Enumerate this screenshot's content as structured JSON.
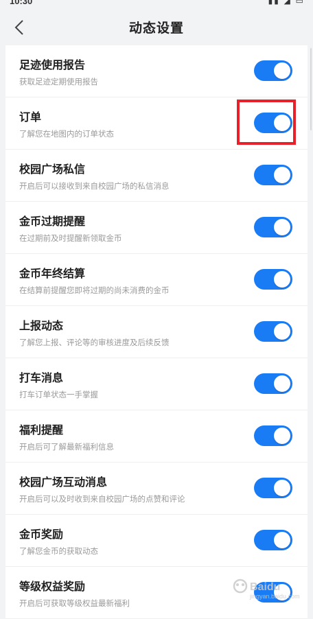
{
  "nav": {
    "title": "动态设置",
    "back_icon": "chevron-left-icon"
  },
  "settings": [
    {
      "title": "足迹使用报告",
      "desc": "获取足迹定期使用报告",
      "on": true
    },
    {
      "title": "订单",
      "desc": "了解您在地图内的订单状态",
      "on": true
    },
    {
      "title": "校园广场私信",
      "desc": "开启后可以接收到来自校园广场的私信消息",
      "on": true
    },
    {
      "title": "金币过期提醒",
      "desc": "在过期前及时提醒新领取金币",
      "on": true
    },
    {
      "title": "金币年终结算",
      "desc": "在结算前提醒您即将过期的尚未消费的金币",
      "on": true
    },
    {
      "title": "上报动态",
      "desc": "了解您上报、评论等的审核进度及后续反馈",
      "on": true
    },
    {
      "title": "打车消息",
      "desc": "打车订单状态一手掌握",
      "on": true
    },
    {
      "title": "福利提醒",
      "desc": "开启后可了解最新福利信息",
      "on": true
    },
    {
      "title": "校园广场互动消息",
      "desc": "开启后可以及时收到来自校园广场的点赞和评论",
      "on": true
    },
    {
      "title": "金币奖励",
      "desc": "了解您金币的获取动态",
      "on": true
    },
    {
      "title": "等级权益奖励",
      "desc": "开启后可获取等级权益最新福利",
      "on": true
    }
  ],
  "colors": {
    "toggle_on": "#1a7cf5",
    "highlight": "#e8202a"
  },
  "watermark": {
    "brand": "Baidu",
    "site": "jingyan.baidu.com"
  }
}
